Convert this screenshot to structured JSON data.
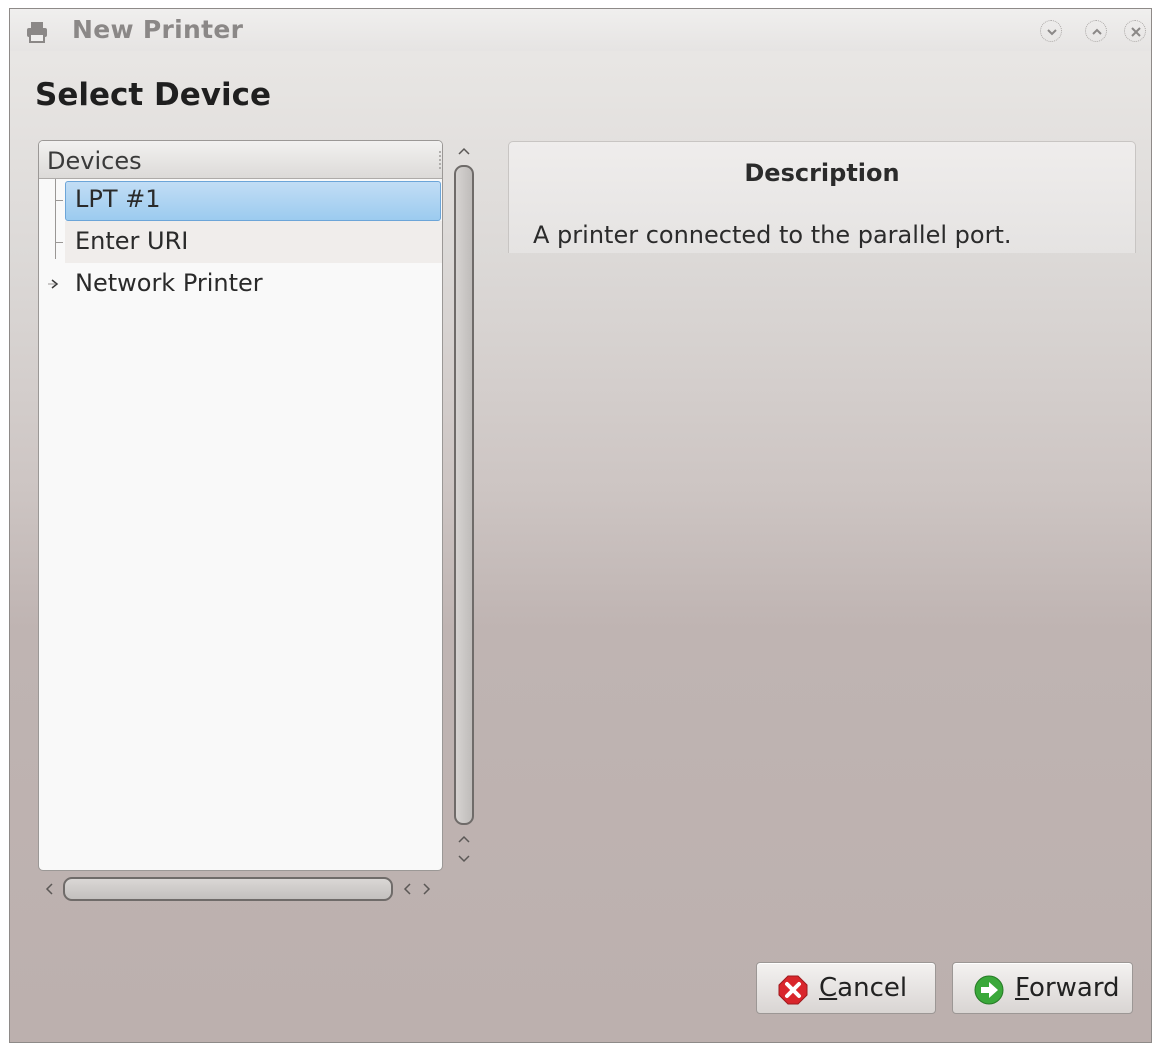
{
  "window": {
    "title": "New Printer",
    "title_icon": "printer-icon",
    "controls": [
      "minimize-icon",
      "maximize-icon",
      "close-icon"
    ]
  },
  "page": {
    "heading": "Select Device"
  },
  "devices": {
    "header": "Devices",
    "items": [
      {
        "label": "LPT #1",
        "selected": true,
        "expandable": false
      },
      {
        "label": "Enter URI",
        "selected": false,
        "expandable": false
      },
      {
        "label": "Network Printer",
        "selected": false,
        "expandable": true
      }
    ]
  },
  "description": {
    "title": "Description",
    "text": "A printer connected to the parallel port."
  },
  "buttons": {
    "cancel": {
      "mnemonic": "C",
      "rest": "ancel",
      "icon": "cancel-icon"
    },
    "forward": {
      "mnemonic": "F",
      "rest": "orward",
      "icon": "forward-icon"
    }
  },
  "colors": {
    "selection": "#9ccbef",
    "cancel_icon": "#d9262c",
    "forward_icon": "#3aa83a"
  }
}
